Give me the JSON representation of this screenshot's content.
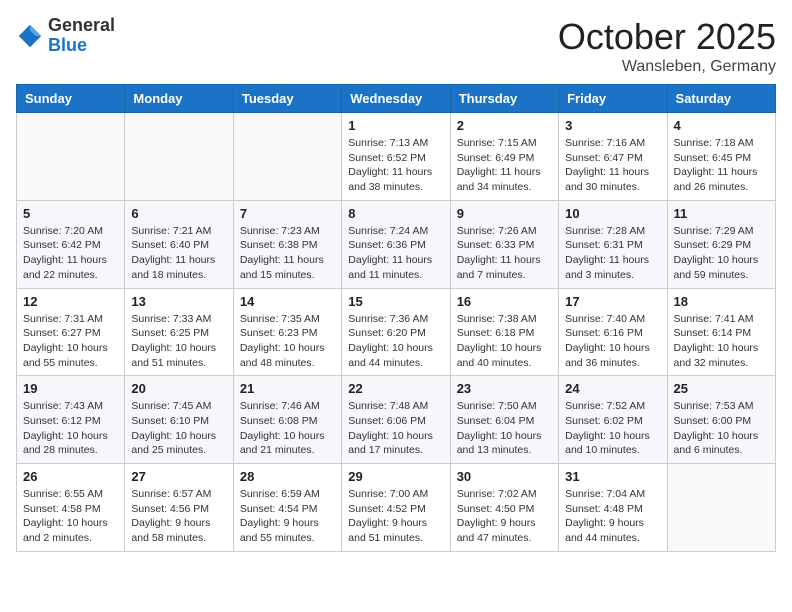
{
  "header": {
    "logo_general": "General",
    "logo_blue": "Blue",
    "month": "October 2025",
    "location": "Wansleben, Germany"
  },
  "weekdays": [
    "Sunday",
    "Monday",
    "Tuesday",
    "Wednesday",
    "Thursday",
    "Friday",
    "Saturday"
  ],
  "weeks": [
    [
      {
        "day": "",
        "info": ""
      },
      {
        "day": "",
        "info": ""
      },
      {
        "day": "",
        "info": ""
      },
      {
        "day": "1",
        "info": "Sunrise: 7:13 AM\nSunset: 6:52 PM\nDaylight: 11 hours\nand 38 minutes."
      },
      {
        "day": "2",
        "info": "Sunrise: 7:15 AM\nSunset: 6:49 PM\nDaylight: 11 hours\nand 34 minutes."
      },
      {
        "day": "3",
        "info": "Sunrise: 7:16 AM\nSunset: 6:47 PM\nDaylight: 11 hours\nand 30 minutes."
      },
      {
        "day": "4",
        "info": "Sunrise: 7:18 AM\nSunset: 6:45 PM\nDaylight: 11 hours\nand 26 minutes."
      }
    ],
    [
      {
        "day": "5",
        "info": "Sunrise: 7:20 AM\nSunset: 6:42 PM\nDaylight: 11 hours\nand 22 minutes."
      },
      {
        "day": "6",
        "info": "Sunrise: 7:21 AM\nSunset: 6:40 PM\nDaylight: 11 hours\nand 18 minutes."
      },
      {
        "day": "7",
        "info": "Sunrise: 7:23 AM\nSunset: 6:38 PM\nDaylight: 11 hours\nand 15 minutes."
      },
      {
        "day": "8",
        "info": "Sunrise: 7:24 AM\nSunset: 6:36 PM\nDaylight: 11 hours\nand 11 minutes."
      },
      {
        "day": "9",
        "info": "Sunrise: 7:26 AM\nSunset: 6:33 PM\nDaylight: 11 hours\nand 7 minutes."
      },
      {
        "day": "10",
        "info": "Sunrise: 7:28 AM\nSunset: 6:31 PM\nDaylight: 11 hours\nand 3 minutes."
      },
      {
        "day": "11",
        "info": "Sunrise: 7:29 AM\nSunset: 6:29 PM\nDaylight: 10 hours\nand 59 minutes."
      }
    ],
    [
      {
        "day": "12",
        "info": "Sunrise: 7:31 AM\nSunset: 6:27 PM\nDaylight: 10 hours\nand 55 minutes."
      },
      {
        "day": "13",
        "info": "Sunrise: 7:33 AM\nSunset: 6:25 PM\nDaylight: 10 hours\nand 51 minutes."
      },
      {
        "day": "14",
        "info": "Sunrise: 7:35 AM\nSunset: 6:23 PM\nDaylight: 10 hours\nand 48 minutes."
      },
      {
        "day": "15",
        "info": "Sunrise: 7:36 AM\nSunset: 6:20 PM\nDaylight: 10 hours\nand 44 minutes."
      },
      {
        "day": "16",
        "info": "Sunrise: 7:38 AM\nSunset: 6:18 PM\nDaylight: 10 hours\nand 40 minutes."
      },
      {
        "day": "17",
        "info": "Sunrise: 7:40 AM\nSunset: 6:16 PM\nDaylight: 10 hours\nand 36 minutes."
      },
      {
        "day": "18",
        "info": "Sunrise: 7:41 AM\nSunset: 6:14 PM\nDaylight: 10 hours\nand 32 minutes."
      }
    ],
    [
      {
        "day": "19",
        "info": "Sunrise: 7:43 AM\nSunset: 6:12 PM\nDaylight: 10 hours\nand 28 minutes."
      },
      {
        "day": "20",
        "info": "Sunrise: 7:45 AM\nSunset: 6:10 PM\nDaylight: 10 hours\nand 25 minutes."
      },
      {
        "day": "21",
        "info": "Sunrise: 7:46 AM\nSunset: 6:08 PM\nDaylight: 10 hours\nand 21 minutes."
      },
      {
        "day": "22",
        "info": "Sunrise: 7:48 AM\nSunset: 6:06 PM\nDaylight: 10 hours\nand 17 minutes."
      },
      {
        "day": "23",
        "info": "Sunrise: 7:50 AM\nSunset: 6:04 PM\nDaylight: 10 hours\nand 13 minutes."
      },
      {
        "day": "24",
        "info": "Sunrise: 7:52 AM\nSunset: 6:02 PM\nDaylight: 10 hours\nand 10 minutes."
      },
      {
        "day": "25",
        "info": "Sunrise: 7:53 AM\nSunset: 6:00 PM\nDaylight: 10 hours\nand 6 minutes."
      }
    ],
    [
      {
        "day": "26",
        "info": "Sunrise: 6:55 AM\nSunset: 4:58 PM\nDaylight: 10 hours\nand 2 minutes."
      },
      {
        "day": "27",
        "info": "Sunrise: 6:57 AM\nSunset: 4:56 PM\nDaylight: 9 hours\nand 58 minutes."
      },
      {
        "day": "28",
        "info": "Sunrise: 6:59 AM\nSunset: 4:54 PM\nDaylight: 9 hours\nand 55 minutes."
      },
      {
        "day": "29",
        "info": "Sunrise: 7:00 AM\nSunset: 4:52 PM\nDaylight: 9 hours\nand 51 minutes."
      },
      {
        "day": "30",
        "info": "Sunrise: 7:02 AM\nSunset: 4:50 PM\nDaylight: 9 hours\nand 47 minutes."
      },
      {
        "day": "31",
        "info": "Sunrise: 7:04 AM\nSunset: 4:48 PM\nDaylight: 9 hours\nand 44 minutes."
      },
      {
        "day": "",
        "info": ""
      }
    ]
  ]
}
